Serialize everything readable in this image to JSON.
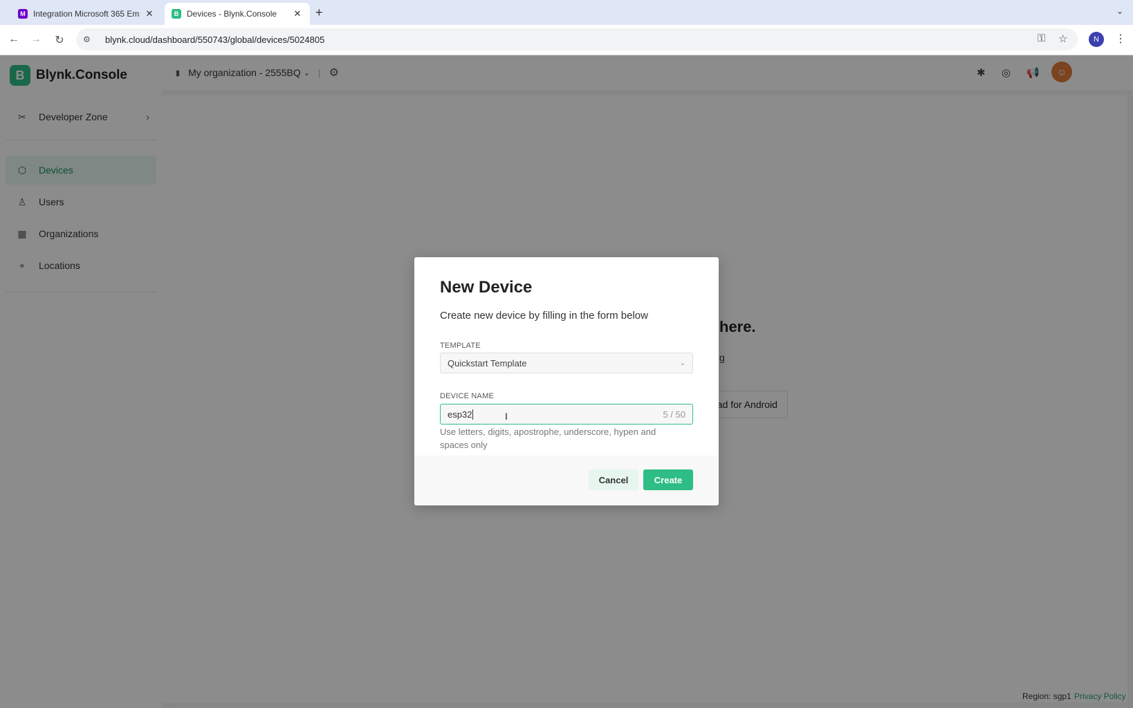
{
  "browser": {
    "tabs": [
      {
        "title": "Integration Microsoft 365 Em",
        "favicon": "make-logo-icon"
      },
      {
        "title": "Devices - Blynk.Console",
        "favicon": "blynk-favicon"
      }
    ],
    "url": "blynk.cloud/dashboard/550743/global/devices/5024805",
    "profile_initial": "N"
  },
  "app": {
    "logo_letter": "B",
    "logo_name": "Blynk.Console",
    "accent_color": "#2ebd85",
    "sidebar": {
      "developer_zone": "Developer Zone",
      "items": [
        {
          "label": "Devices",
          "icon": "cube-icon",
          "active": true
        },
        {
          "label": "Users",
          "icon": "users-icon"
        },
        {
          "label": "Organizations",
          "icon": "building-icon"
        },
        {
          "label": "Locations",
          "icon": "pin-icon"
        }
      ]
    },
    "header": {
      "org_name": "My organization - 2555BQ"
    },
    "background": {
      "heading_fragment": "here.",
      "text_fragment": "g",
      "android_button": "oad for Android"
    },
    "footer": {
      "region": "Region: sgp1",
      "privacy": "Privacy Policy"
    }
  },
  "modal": {
    "title": "New Device",
    "subtitle": "Create new device by filling in the form below",
    "template_label": "TEMPLATE",
    "template_value": "Quickstart Template",
    "device_name_label": "DEVICE NAME",
    "device_name_value": "esp32",
    "counter": "5 / 50",
    "hint": "Use letters, digits, apostrophe, underscore, hypen and spaces only",
    "cancel": "Cancel",
    "create": "Create"
  }
}
